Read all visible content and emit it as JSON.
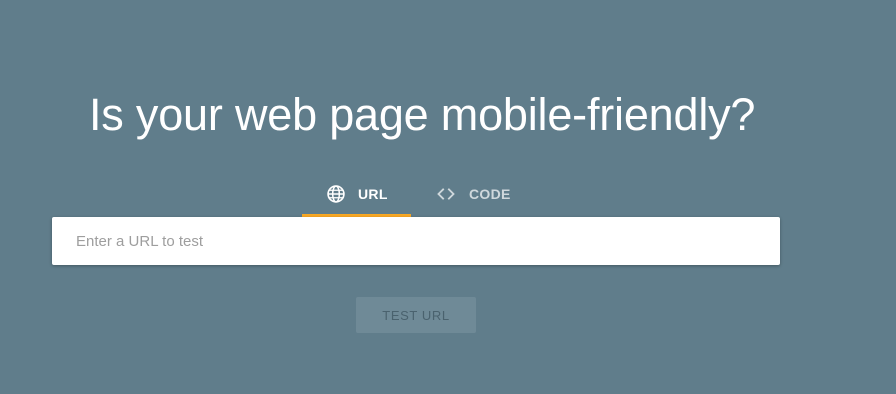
{
  "page": {
    "headline": "Is your web page mobile-friendly?",
    "background_color": "#607d8b",
    "accent_color": "#f9a825"
  },
  "tabs": [
    {
      "label": "URL",
      "icon": "globe-icon",
      "selected": true
    },
    {
      "label": "CODE",
      "icon": "code-icon",
      "selected": false
    }
  ],
  "url_input": {
    "value": "",
    "placeholder": "Enter a URL to test"
  },
  "test_button": {
    "label": "TEST URL",
    "disabled": true
  }
}
